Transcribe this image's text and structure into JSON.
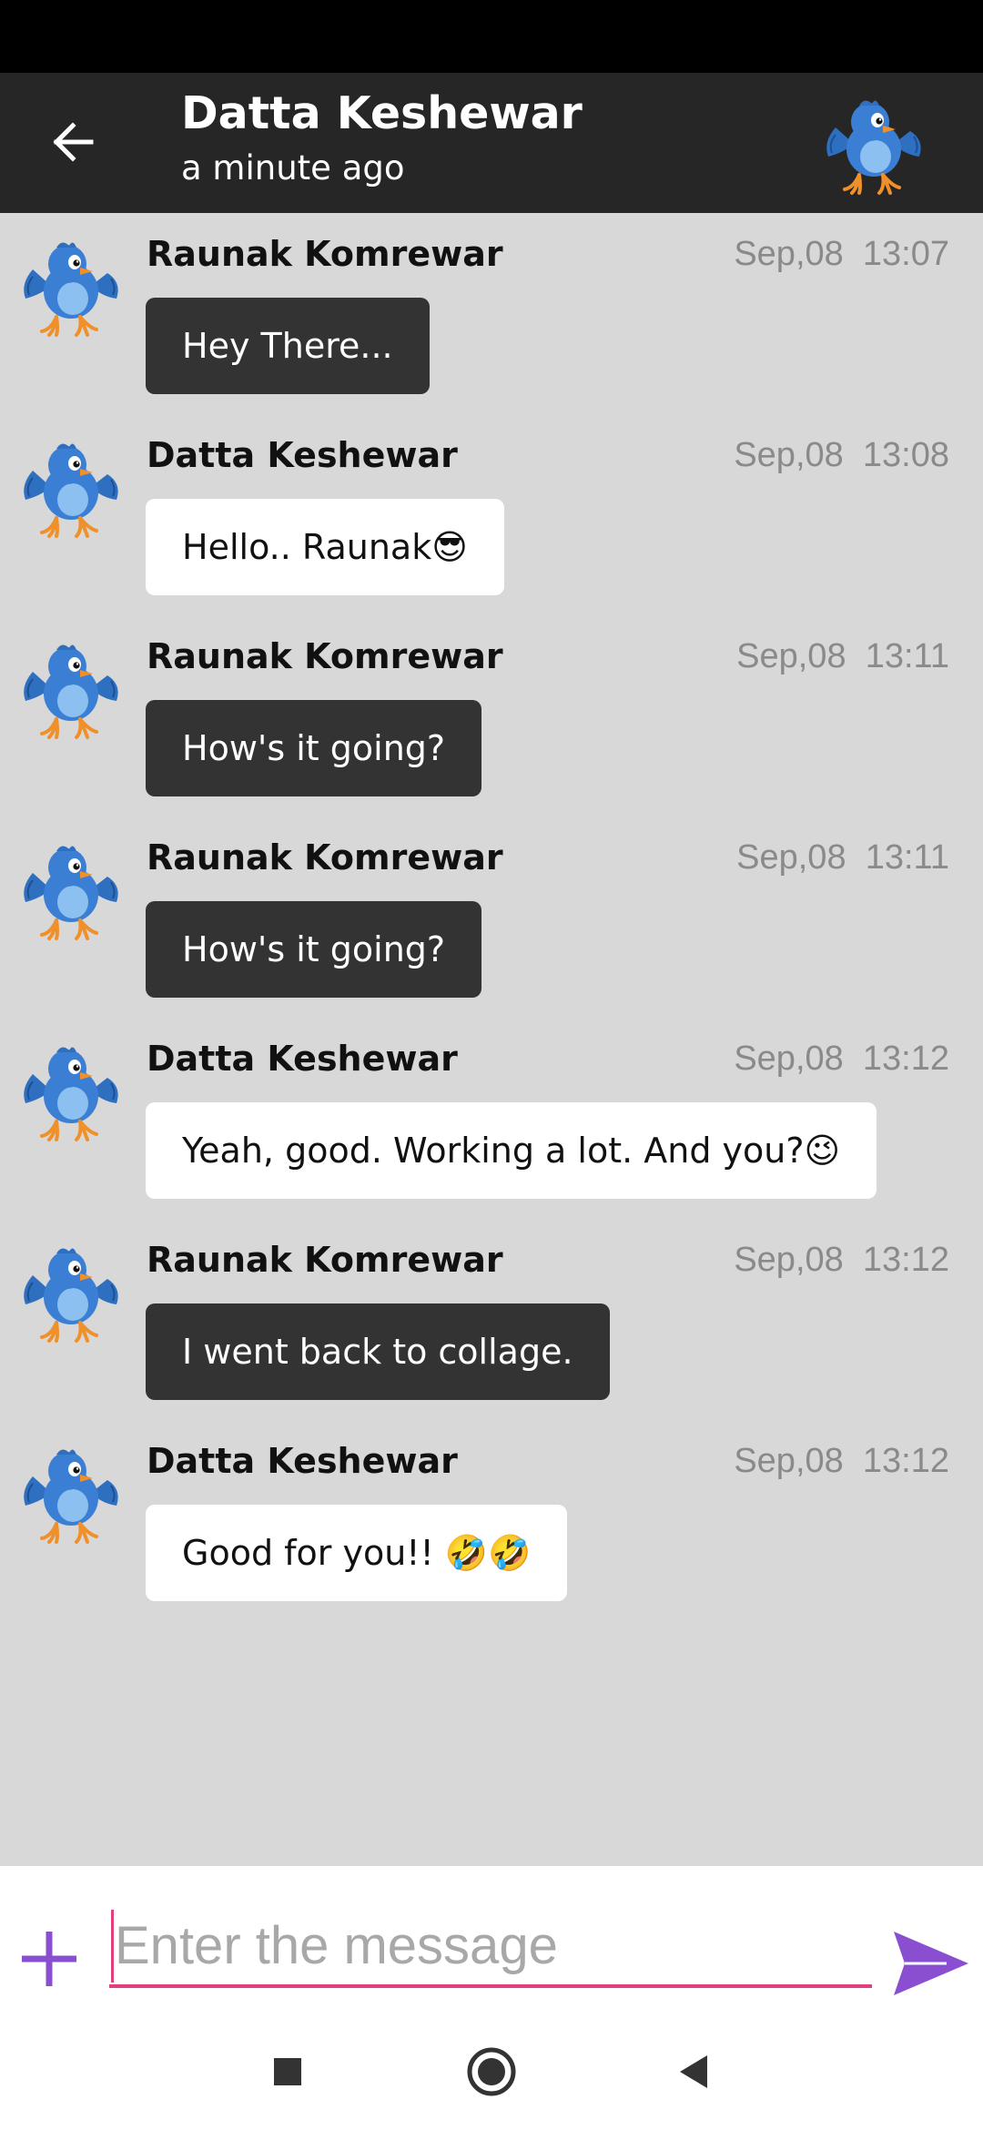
{
  "header": {
    "contact_name": "Datta Keshewar",
    "last_seen": "a minute ago"
  },
  "messages": [
    {
      "sender": "Raunak Komrewar",
      "date": "Sep,08",
      "time": "13:07",
      "text": "Hey There...",
      "style": "dark"
    },
    {
      "sender": "Datta Keshewar",
      "date": "Sep,08",
      "time": "13:08",
      "text": "Hello.. Raunak😎",
      "style": "light"
    },
    {
      "sender": "Raunak Komrewar",
      "date": "Sep,08",
      "time": "13:11",
      "text": "How's it going?",
      "style": "dark"
    },
    {
      "sender": "Raunak Komrewar",
      "date": "Sep,08",
      "time": "13:11",
      "text": "How's it going?",
      "style": "dark"
    },
    {
      "sender": "Datta Keshewar",
      "date": "Sep,08",
      "time": "13:12",
      "text": "Yeah, good. Working a lot. And you?😉",
      "style": "light"
    },
    {
      "sender": "Raunak Komrewar",
      "date": "Sep,08",
      "time": "13:12",
      "text": "I went back to collage.",
      "style": "dark"
    },
    {
      "sender": "Datta Keshewar",
      "date": "Sep,08",
      "time": "13:12",
      "text": "Good for you!! 🤣🤣",
      "style": "light"
    }
  ],
  "composer": {
    "placeholder": "Enter the message",
    "value": ""
  },
  "icons": {
    "back": "arrow-back-icon",
    "avatar": "blue-bird-avatar",
    "plus": "plus-icon",
    "send": "send-icon",
    "nav_recents": "square-icon",
    "nav_home": "circle-icon",
    "nav_back": "triangle-back-icon"
  },
  "colors": {
    "app_bar": "#262626",
    "chat_background": "#d8d8d8",
    "dark_bubble": "#333333",
    "light_bubble": "#ffffff",
    "accent_purple": "#8a4fd1",
    "input_underline": "#e0407d"
  }
}
